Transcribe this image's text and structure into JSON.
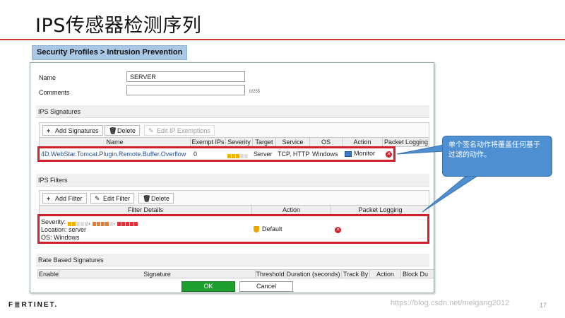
{
  "slide": {
    "title": "IPS传感器检测序列",
    "callout": "单个签名动作将覆盖任何基于过滤的动作。",
    "footer_logo": "F≣RTINET.",
    "watermark": "https://blog.csdn.net/meigang2012",
    "page_number": "17"
  },
  "breadcrumb": "Security Profiles > Intrusion Prevention",
  "form": {
    "name_label": "Name",
    "name_value": "SERVER",
    "comments_label": "Comments",
    "comments_value": "",
    "comments_counter": "0/255"
  },
  "ips_signatures": {
    "section_label": "IPS Signatures",
    "toolbar": {
      "add": "Add Signatures",
      "delete": "Delete",
      "edit_exemptions": "Edit IP Exemptions"
    },
    "columns": [
      "Name",
      "Exempt IPs",
      "Severity",
      "Target",
      "Service",
      "OS",
      "Action",
      "Packet Logging"
    ],
    "row": {
      "name": "4D.WebStar.Tomcat.Plugin.Remote.Buffer.Overflow",
      "exempt_ips": "0",
      "severity_level": 3,
      "target": "Server",
      "service": "TCP, HTTP",
      "os": "Windows",
      "action": "Monitor",
      "packet_logging_icon": "disabled-x-icon"
    }
  },
  "ips_filters": {
    "section_label": "IPS Filters",
    "toolbar": {
      "add": "Add Filter",
      "edit": "Edit Filter",
      "delete": "Delete"
    },
    "columns": [
      "Filter Details",
      "Action",
      "Packet Logging"
    ],
    "row": {
      "severity_label": "Severity:",
      "severity_levels": [
        2,
        4,
        5
      ],
      "location": "Location: server",
      "os": "OS: Windows",
      "action": "Default",
      "packet_logging_icon": "disabled-x-icon"
    }
  },
  "rate_based": {
    "section_label": "Rate Based Signatures",
    "columns": [
      "Enable",
      "Signature",
      "Threshold",
      "Duration (seconds)",
      "Track By",
      "Action",
      "Block Du"
    ]
  },
  "buttons": {
    "ok": "OK",
    "cancel": "Cancel"
  },
  "colors": {
    "title_rule": "#c0392b",
    "highlight_border": "#d0202a",
    "ok_button": "#1e9e2e",
    "callout": "#4d8fd1",
    "severity_low": "#f0b400",
    "severity_medium": "#f07a2a",
    "severity_critical": "#e0303a"
  }
}
